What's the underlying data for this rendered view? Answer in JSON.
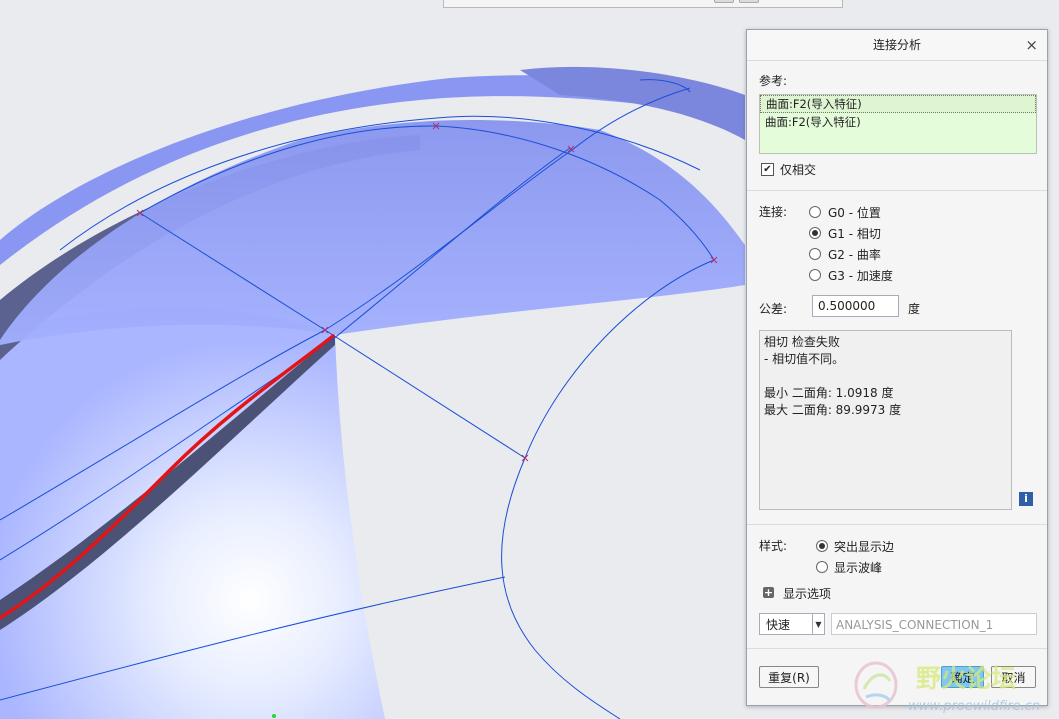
{
  "dialog": {
    "title": "连接分析",
    "close": "×",
    "reference_label": "参考:",
    "references": [
      "曲面:F2(导入特征)",
      "曲面:F2(导入特征)"
    ],
    "only_intersect_label": "仅相交",
    "only_intersect_checked": true,
    "connection_label": "连接:",
    "connection_options": [
      "G0 - 位置",
      "G1 - 相切",
      "G2 - 曲率",
      "G3 - 加速度"
    ],
    "connection_selected": "G1 - 相切",
    "tolerance_label": "公差:",
    "tolerance_value": "0.500000",
    "tolerance_unit": "度",
    "result_lines": [
      "相切 检查失败",
      "- 相切值不同。",
      "",
      "最小 二面角: 1.0918 度",
      "最大 二面角: 89.9973 度"
    ],
    "info_icon": "i",
    "style_label": "样式:",
    "style_options": [
      "突出显示边",
      "显示波峰"
    ],
    "style_selected": "突出显示边",
    "display_options_label": "显示选项",
    "mode_value": "快速",
    "analysis_name": "ANALYSIS_CONNECTION_1",
    "repeat_button": "重复(R)",
    "ok_button": "确定",
    "cancel_button": "取消"
  },
  "watermark": {
    "text_cn": "野火论坛",
    "text_url": "www.proewildfire.cn"
  },
  "colors": {
    "surface": "#9aa6f8",
    "curve": "#1a4fd6",
    "highlight_edge": "#e41414",
    "ref_list_bg": "#e4fcd9",
    "ok_button": "#7fc7ee"
  }
}
